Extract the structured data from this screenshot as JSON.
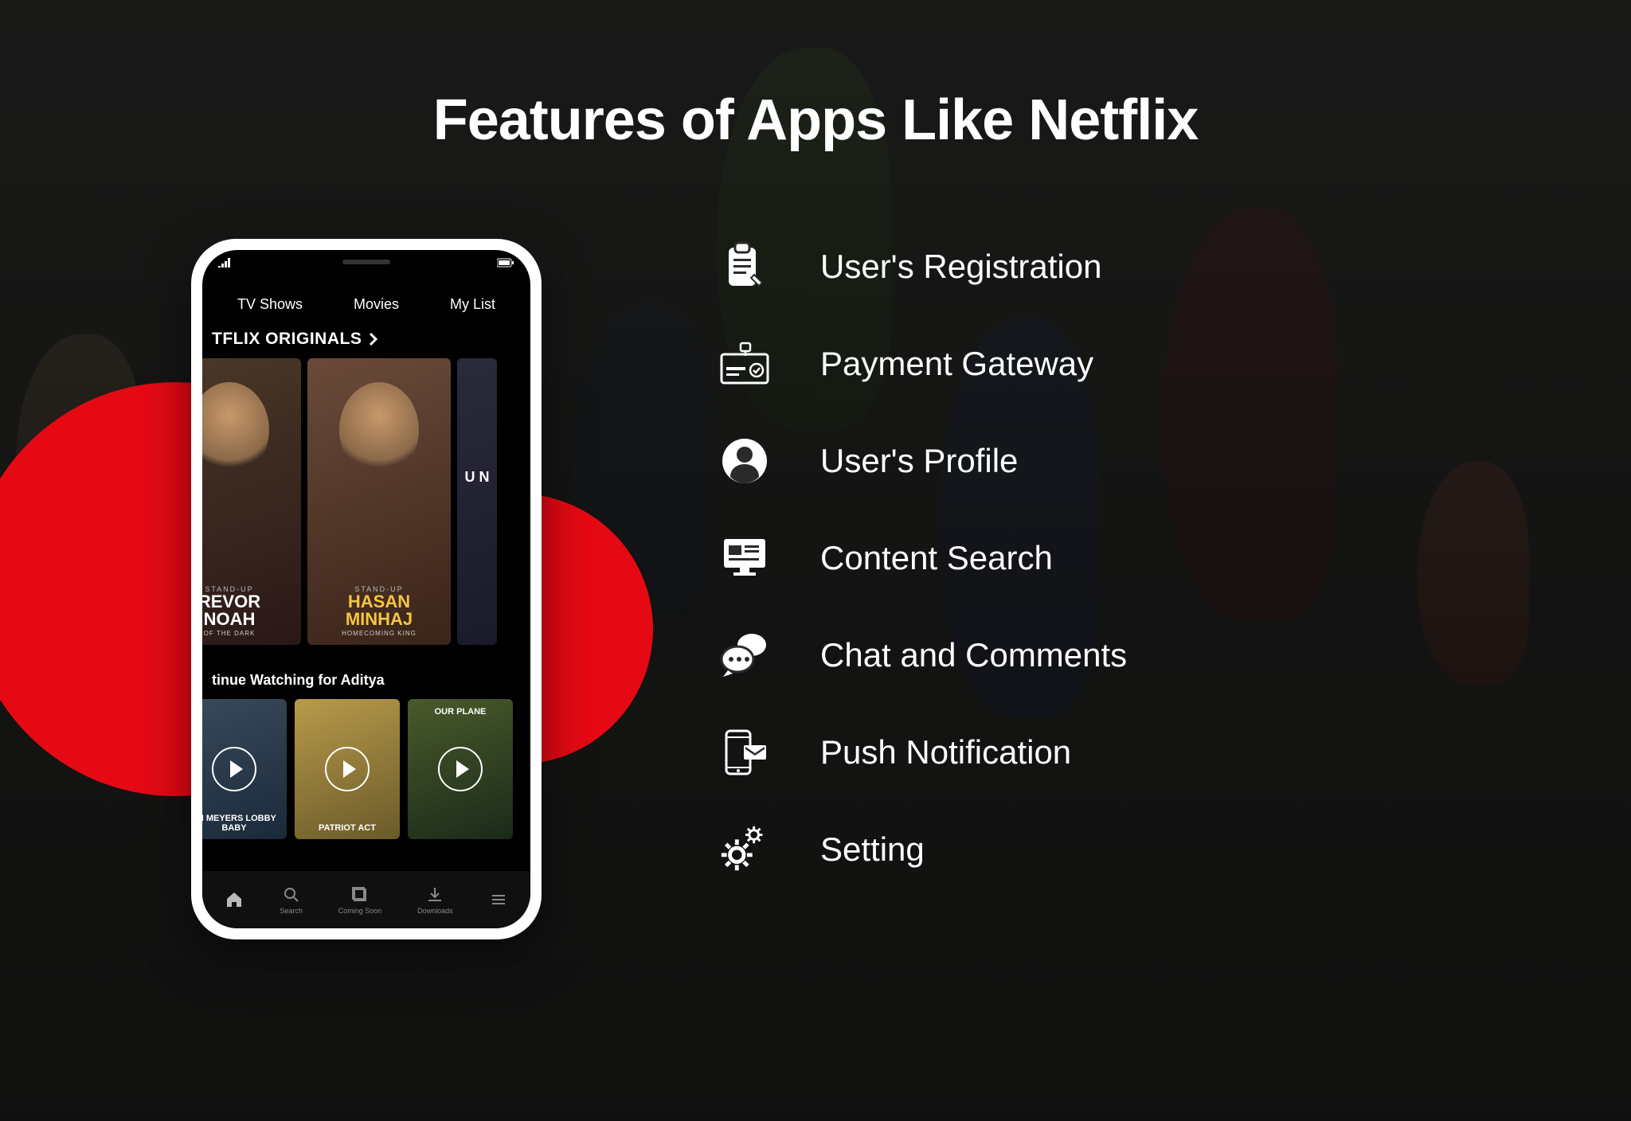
{
  "heading": "Features of Apps Like Netflix",
  "phone": {
    "nav": {
      "tab1": "TV Shows",
      "tab2": "Movies",
      "tab3": "My List"
    },
    "section1_title": "TFLIX ORIGINALS",
    "posters": {
      "p1": {
        "small": "STAND-UP",
        "name1": "REVOR",
        "name2": "NOAH",
        "sub": "OF THE DARK"
      },
      "p2": {
        "small": "STAND-UP",
        "name1": "HASAN",
        "name2": "MINHAJ",
        "sub": "HOMECOMING KING"
      },
      "p3": {
        "text": "U  N"
      }
    },
    "continue_title": "tinue Watching for Aditya",
    "thumbs": {
      "t1": "TH MEYERS\nLOBBY BABY",
      "t2": "PATRIOT\nACT",
      "t3": "OUR PLANE"
    },
    "tabbar": {
      "i1": "Home",
      "i2": "Search",
      "i3": "Coming Soon",
      "i4": "Downloads",
      "i5": "More"
    }
  },
  "features": [
    {
      "icon": "clipboard",
      "label": "User's Registration"
    },
    {
      "icon": "payment",
      "label": "Payment Gateway"
    },
    {
      "icon": "profile",
      "label": "User's Profile"
    },
    {
      "icon": "search",
      "label": "Content Search"
    },
    {
      "icon": "chat",
      "label": "Chat and Comments"
    },
    {
      "icon": "push",
      "label": "Push Notification"
    },
    {
      "icon": "setting",
      "label": "Setting"
    }
  ]
}
